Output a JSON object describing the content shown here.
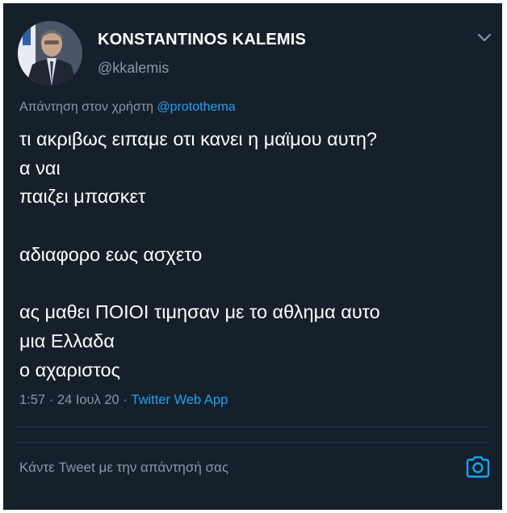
{
  "author": {
    "display_name": "KONSTANTINOS KALEMIS",
    "handle": "@kkalemis",
    "avatar_icon": "profile-photo"
  },
  "reply_context": {
    "prefix": "Απάντηση στον χρήστη",
    "mention": "@protothema"
  },
  "tweet": {
    "lines": [
      "τι ακριβως ειπαμε οτι κανει η μαϊμου αυτη?",
      "α ναι",
      "παιζει μπασκετ",
      "",
      "αδιαφορο εως ασχετο",
      "",
      "ας μαθει ΠΟΙΟΙ τιμησαν με το αθλημα αυτο",
      "μια Ελλαδα",
      "ο αχαριστος"
    ]
  },
  "meta": {
    "time": "1:57",
    "separator": "·",
    "date": "24 Ιουλ 20",
    "source": "Twitter Web App"
  },
  "reply_box": {
    "placeholder": "Κάντε Tweet με την απάντησή σας",
    "camera_icon": "camera-icon"
  },
  "colors": {
    "background": "#15202b",
    "text": "#ffffff",
    "secondary": "#8899a6",
    "accent": "#1da1f2"
  }
}
